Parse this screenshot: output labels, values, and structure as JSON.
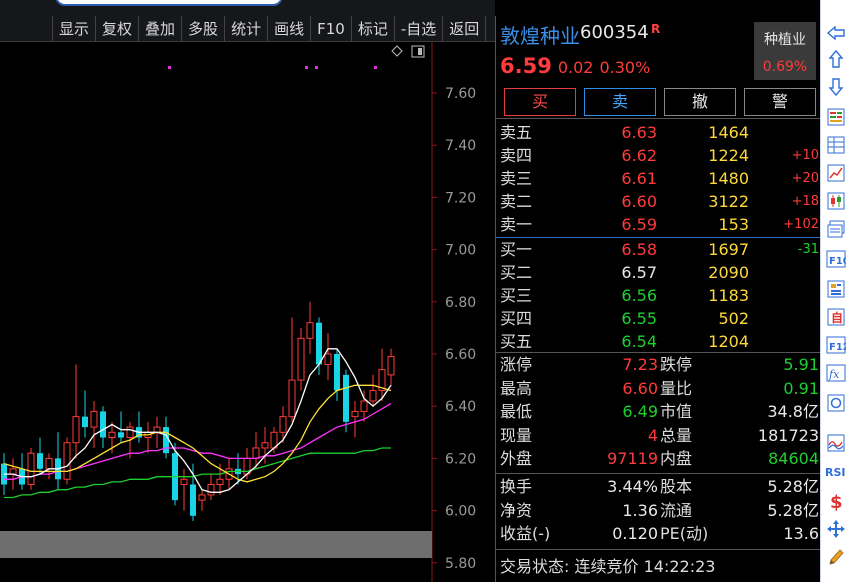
{
  "toolbar": {
    "buttons": [
      "显示",
      "复权",
      "叠加",
      "多股",
      "统计",
      "画线",
      "F10",
      "标记",
      "-自选",
      "返回"
    ]
  },
  "chart": {
    "price_axis_labels": [
      "7.60",
      "7.40",
      "7.20",
      "7.00",
      "6.80",
      "6.60",
      "6.40",
      "6.20",
      "6.00",
      "5.80"
    ]
  },
  "chart_data": {
    "type": "candlestick",
    "ylim": [
      5.8,
      7.68
    ],
    "y_ticks": [
      7.6,
      7.4,
      7.2,
      7.0,
      6.8,
      6.6,
      6.4,
      6.2,
      6.0,
      5.8
    ],
    "candles": [
      {
        "o": 6.18,
        "h": 6.22,
        "l": 6.06,
        "c": 6.1
      },
      {
        "o": 6.14,
        "h": 6.2,
        "l": 6.08,
        "c": 6.16
      },
      {
        "o": 6.16,
        "h": 6.22,
        "l": 6.08,
        "c": 6.1
      },
      {
        "o": 6.1,
        "h": 6.24,
        "l": 6.08,
        "c": 6.22
      },
      {
        "o": 6.22,
        "h": 6.28,
        "l": 6.14,
        "c": 6.16
      },
      {
        "o": 6.16,
        "h": 6.22,
        "l": 6.12,
        "c": 6.2
      },
      {
        "o": 6.2,
        "h": 6.3,
        "l": 6.08,
        "c": 6.12
      },
      {
        "o": 6.12,
        "h": 6.28,
        "l": 6.1,
        "c": 6.26
      },
      {
        "o": 6.26,
        "h": 6.56,
        "l": 6.2,
        "c": 6.36
      },
      {
        "o": 6.36,
        "h": 6.46,
        "l": 6.28,
        "c": 6.32
      },
      {
        "o": 6.32,
        "h": 6.42,
        "l": 6.24,
        "c": 6.38
      },
      {
        "o": 6.38,
        "h": 6.4,
        "l": 6.24,
        "c": 6.28
      },
      {
        "o": 6.28,
        "h": 6.34,
        "l": 6.22,
        "c": 6.3
      },
      {
        "o": 6.3,
        "h": 6.38,
        "l": 6.26,
        "c": 6.28
      },
      {
        "o": 6.28,
        "h": 6.34,
        "l": 6.2,
        "c": 6.32
      },
      {
        "o": 6.32,
        "h": 6.38,
        "l": 6.26,
        "c": 6.28
      },
      {
        "o": 6.28,
        "h": 6.34,
        "l": 6.22,
        "c": 6.3
      },
      {
        "o": 6.3,
        "h": 6.36,
        "l": 6.24,
        "c": 6.32
      },
      {
        "o": 6.32,
        "h": 6.36,
        "l": 6.2,
        "c": 6.22
      },
      {
        "o": 6.22,
        "h": 6.26,
        "l": 6.02,
        "c": 6.04
      },
      {
        "o": 6.1,
        "h": 6.16,
        "l": 6.0,
        "c": 6.12
      },
      {
        "o": 6.1,
        "h": 6.18,
        "l": 5.96,
        "c": 5.98
      },
      {
        "o": 6.04,
        "h": 6.08,
        "l": 6.0,
        "c": 6.06
      },
      {
        "o": 6.06,
        "h": 6.14,
        "l": 6.04,
        "c": 6.1
      },
      {
        "o": 6.1,
        "h": 6.18,
        "l": 6.06,
        "c": 6.12
      },
      {
        "o": 6.12,
        "h": 6.2,
        "l": 6.08,
        "c": 6.16
      },
      {
        "o": 6.16,
        "h": 6.22,
        "l": 6.1,
        "c": 6.14
      },
      {
        "o": 6.14,
        "h": 6.24,
        "l": 6.12,
        "c": 6.2
      },
      {
        "o": 6.2,
        "h": 6.3,
        "l": 6.16,
        "c": 6.24
      },
      {
        "o": 6.24,
        "h": 6.32,
        "l": 6.18,
        "c": 6.26
      },
      {
        "o": 6.24,
        "h": 6.32,
        "l": 6.22,
        "c": 6.3
      },
      {
        "o": 6.3,
        "h": 6.4,
        "l": 6.26,
        "c": 6.36
      },
      {
        "o": 6.36,
        "h": 6.74,
        "l": 6.34,
        "c": 6.5
      },
      {
        "o": 6.5,
        "h": 6.7,
        "l": 6.46,
        "c": 6.66
      },
      {
        "o": 6.66,
        "h": 6.8,
        "l": 6.6,
        "c": 6.72
      },
      {
        "o": 6.72,
        "h": 6.74,
        "l": 6.52,
        "c": 6.56
      },
      {
        "o": 6.56,
        "h": 6.68,
        "l": 6.5,
        "c": 6.6
      },
      {
        "o": 6.6,
        "h": 6.62,
        "l": 6.42,
        "c": 6.46
      },
      {
        "o": 6.52,
        "h": 6.54,
        "l": 6.3,
        "c": 6.34
      },
      {
        "o": 6.36,
        "h": 6.42,
        "l": 6.28,
        "c": 6.38
      },
      {
        "o": 6.38,
        "h": 6.46,
        "l": 6.34,
        "c": 6.42
      },
      {
        "o": 6.42,
        "h": 6.52,
        "l": 6.4,
        "c": 6.46
      },
      {
        "o": 6.46,
        "h": 6.62,
        "l": 6.42,
        "c": 6.54
      },
      {
        "o": 6.52,
        "h": 6.62,
        "l": 6.48,
        "c": 6.59
      }
    ],
    "ma5": [
      6.14,
      6.14,
      6.13,
      6.13,
      6.14,
      6.16,
      6.16,
      6.17,
      6.21,
      6.24,
      6.29,
      6.31,
      6.33,
      6.31,
      6.31,
      6.3,
      6.3,
      6.3,
      6.29,
      6.23,
      6.19,
      6.14,
      6.08,
      6.07,
      6.07,
      6.08,
      6.11,
      6.14,
      6.17,
      6.21,
      6.24,
      6.27,
      6.33,
      6.42,
      6.52,
      6.56,
      6.62,
      6.62,
      6.57,
      6.51,
      6.43,
      6.4,
      6.43,
      6.48
    ],
    "ma10": [
      6.18,
      6.17,
      6.16,
      6.15,
      6.15,
      6.15,
      6.15,
      6.15,
      6.16,
      6.18,
      6.2,
      6.22,
      6.24,
      6.26,
      6.27,
      6.29,
      6.29,
      6.3,
      6.3,
      6.28,
      6.26,
      6.24,
      6.21,
      6.18,
      6.16,
      6.14,
      6.12,
      6.11,
      6.12,
      6.13,
      6.15,
      6.18,
      6.22,
      6.27,
      6.34,
      6.39,
      6.43,
      6.46,
      6.47,
      6.48,
      6.48,
      6.48,
      6.47,
      6.46
    ],
    "ma20": [
      6.12,
      6.12,
      6.13,
      6.13,
      6.14,
      6.14,
      6.15,
      6.15,
      6.16,
      6.17,
      6.18,
      6.19,
      6.2,
      6.21,
      6.22,
      6.22,
      6.23,
      6.23,
      6.24,
      6.24,
      6.24,
      6.23,
      6.22,
      6.22,
      6.21,
      6.2,
      6.2,
      6.2,
      6.2,
      6.21,
      6.21,
      6.22,
      6.23,
      6.24,
      6.26,
      6.28,
      6.3,
      6.32,
      6.33,
      6.34,
      6.35,
      6.37,
      6.39,
      6.41
    ],
    "ma60": [
      6.05,
      6.05,
      6.06,
      6.06,
      6.07,
      6.07,
      6.08,
      6.08,
      6.09,
      6.09,
      6.1,
      6.1,
      6.11,
      6.11,
      6.12,
      6.12,
      6.12,
      6.13,
      6.13,
      6.13,
      6.13,
      6.13,
      6.14,
      6.14,
      6.14,
      6.15,
      6.15,
      6.15,
      6.16,
      6.17,
      6.18,
      6.19,
      6.2,
      6.21,
      6.22,
      6.22,
      6.22,
      6.22,
      6.22,
      6.22,
      6.23,
      6.23,
      6.24,
      6.24
    ]
  },
  "quote": {
    "name": "敦煌种业",
    "code": "600354",
    "r_mark": "R",
    "price": "6.59",
    "change": "0.02",
    "change_pct": "0.30%",
    "sector_name": "种植业",
    "sector_pct": "0.69%",
    "trade_buttons": {
      "buy": "买",
      "sell": "卖",
      "cancel": "撤",
      "alert": "警"
    },
    "asks": [
      {
        "label": "卖五",
        "price": "6.63",
        "vol": "1464",
        "chg": "",
        "price_color": "red",
        "chg_color": "red"
      },
      {
        "label": "卖四",
        "price": "6.62",
        "vol": "1224",
        "chg": "+10",
        "price_color": "red",
        "chg_color": "red"
      },
      {
        "label": "卖三",
        "price": "6.61",
        "vol": "1480",
        "chg": "+20",
        "price_color": "red",
        "chg_color": "red"
      },
      {
        "label": "卖二",
        "price": "6.60",
        "vol": "3122",
        "chg": "+18",
        "price_color": "red",
        "chg_color": "red"
      },
      {
        "label": "卖一",
        "price": "6.59",
        "vol": "153",
        "chg": "+102",
        "price_color": "red",
        "chg_color": "red"
      }
    ],
    "bids": [
      {
        "label": "买一",
        "price": "6.58",
        "vol": "1697",
        "chg": "-31",
        "price_color": "red",
        "chg_color": "green"
      },
      {
        "label": "买二",
        "price": "6.57",
        "vol": "2090",
        "chg": "",
        "price_color": "white",
        "chg_color": "green"
      },
      {
        "label": "买三",
        "price": "6.56",
        "vol": "1183",
        "chg": "",
        "price_color": "green",
        "chg_color": "green"
      },
      {
        "label": "买四",
        "price": "6.55",
        "vol": "502",
        "chg": "",
        "price_color": "green",
        "chg_color": "green"
      },
      {
        "label": "买五",
        "price": "6.54",
        "vol": "1204",
        "chg": "",
        "price_color": "green",
        "chg_color": "green"
      }
    ],
    "stats1": [
      {
        "l1": "涨停",
        "v1": "7.23",
        "c1": "red",
        "l2": "跌停",
        "v2": "5.91",
        "c2": "green"
      },
      {
        "l1": "最高",
        "v1": "6.60",
        "c1": "red",
        "l2": "量比",
        "v2": "0.91",
        "c2": "green"
      },
      {
        "l1": "最低",
        "v1": "6.49",
        "c1": "green",
        "l2": "市值",
        "v2": "34.8亿",
        "c2": "white"
      },
      {
        "l1": "现量",
        "v1": "4",
        "c1": "red",
        "l2": "总量",
        "v2": "181723",
        "c2": "white"
      },
      {
        "l1": "外盘",
        "v1": "97119",
        "c1": "red",
        "l2": "内盘",
        "v2": "84604",
        "c2": "green"
      }
    ],
    "stats2": [
      {
        "l1": "换手",
        "v1": "3.44%",
        "c1": "white",
        "l2": "股本",
        "v2": "5.28亿",
        "c2": "white"
      },
      {
        "l1": "净资",
        "v1": "1.36",
        "c1": "white",
        "l2": "流通",
        "v2": "5.28亿",
        "c2": "white"
      },
      {
        "l1": "收益(-)",
        "v1": "0.120",
        "c1": "white",
        "l2": "PE(动)",
        "v2": "13.6",
        "c2": "white"
      }
    ],
    "trade_state_label": "交易状态:",
    "trade_state": "连续竞价",
    "time": "14:22:23"
  },
  "colors": {
    "up": "#ff3b3b",
    "down": "#1ed12e",
    "ma5": "#ffffff",
    "ma10": "#ffe033",
    "ma20": "#ff33ff",
    "ma60": "#1ed12e"
  },
  "rightbar_icons": [
    "arrow-left-icon",
    "arrow-up-icon",
    "arrow-down-icon",
    "list-icon",
    "table-icon",
    "line-chart-icon",
    "candle-icon",
    "window-icon",
    "f10-icon",
    "info-icon",
    "self-icon",
    "f12-icon",
    "fx-icon",
    "circle-icon",
    "wave-icon",
    "rsi-icon",
    "dollar-icon",
    "move-icon",
    "pen-icon"
  ]
}
